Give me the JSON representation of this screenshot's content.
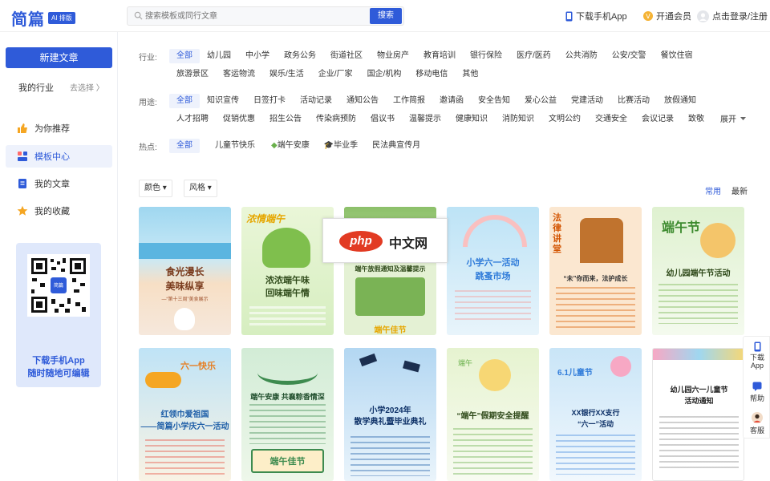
{
  "header": {
    "logo": "简篇",
    "logo_badge": "AI 排版",
    "search_placeholder": "搜索模板或同行文章",
    "search_button": "搜索",
    "download_app": "下载手机App",
    "vip": "开通会员",
    "login": "点击登录/注册"
  },
  "sidebar": {
    "new_article": "新建文章",
    "my_industry": "我的行业",
    "choose": "去选择 〉",
    "items": [
      {
        "label": "为你推荐",
        "icon": "thumb-up-icon"
      },
      {
        "label": "模板中心",
        "icon": "template-icon"
      },
      {
        "label": "我的文章",
        "icon": "document-icon"
      },
      {
        "label": "我的收藏",
        "icon": "star-icon"
      }
    ],
    "promo_line1": "下载手机App",
    "promo_line2": "随时随地可编辑",
    "qr_caption": "简篇"
  },
  "filters": {
    "industry_label": "行业:",
    "industry_row1": [
      "全部",
      "幼儿园",
      "中小学",
      "政务公务",
      "街道社区",
      "物业房产",
      "教育培训",
      "银行保险",
      "医疗/医药",
      "公共消防",
      "公安/交警",
      "餐饮住宿"
    ],
    "industry_row2": [
      "旅游景区",
      "客运物流",
      "娱乐/生活",
      "企业/厂家",
      "国企/机构",
      "移动电信",
      "其他"
    ],
    "usage_label": "用途:",
    "usage_row1": [
      "全部",
      "知识宣传",
      "日签打卡",
      "活动记录",
      "通知公告",
      "工作简报",
      "邀请函",
      "安全告知",
      "爱心公益",
      "党建活动",
      "比赛活动",
      "放假通知"
    ],
    "usage_row2": [
      "人才招聘",
      "促销优惠",
      "招生公告",
      "传染病预防",
      "倡议书",
      "温馨提示",
      "健康知识",
      "消防知识",
      "文明公约",
      "交通安全",
      "会议记录",
      "致敬"
    ],
    "expand": "展开",
    "hot_label": "热点:",
    "hot_items": [
      "全部",
      "儿童节快乐",
      "端午安康",
      "毕业季",
      "民法典宣传月"
    ],
    "color": "颜色",
    "style": "风格",
    "sort_common": "常用",
    "sort_latest": "最新"
  },
  "cards_row1": [
    {
      "title": "食光漫长\n美味纵享",
      "sub": "—“第十三周”美食展示"
    },
    {
      "title": "浓浓端午味\n回味端午情",
      "sub": "浓情端午"
    },
    {
      "title": "端午放假通知及温馨提示",
      "sub": "端午佳节"
    },
    {
      "title": "小学六一活动\n跳蚤市场",
      "sub": ""
    },
    {
      "title": "“未”你而来，法护成长",
      "sub": "法律讲堂"
    },
    {
      "title": "幼儿园端午节活动",
      "sub": "端午节"
    }
  ],
  "cards_row2": [
    {
      "title": "红领巾爱祖国\n——简篇小学庆六一活动",
      "sub": "六一快乐"
    },
    {
      "title": "端午安康 共襄粽香情深",
      "sub": "端午佳节"
    },
    {
      "title": "小学2024年\n散学典礼暨毕业典礼",
      "sub": ""
    },
    {
      "title": "“端午”假期安全提醒",
      "sub": "端午"
    },
    {
      "title": "XX银行XX支行\n“六一”活动",
      "sub": "6.1儿童节"
    },
    {
      "title": "幼儿园六一儿童节\n活动通知",
      "sub": ""
    }
  ],
  "float": {
    "download": "下载\nApp",
    "help": "帮助",
    "service": "客服"
  },
  "watermark": {
    "php": "php",
    "cn": "中文网"
  }
}
